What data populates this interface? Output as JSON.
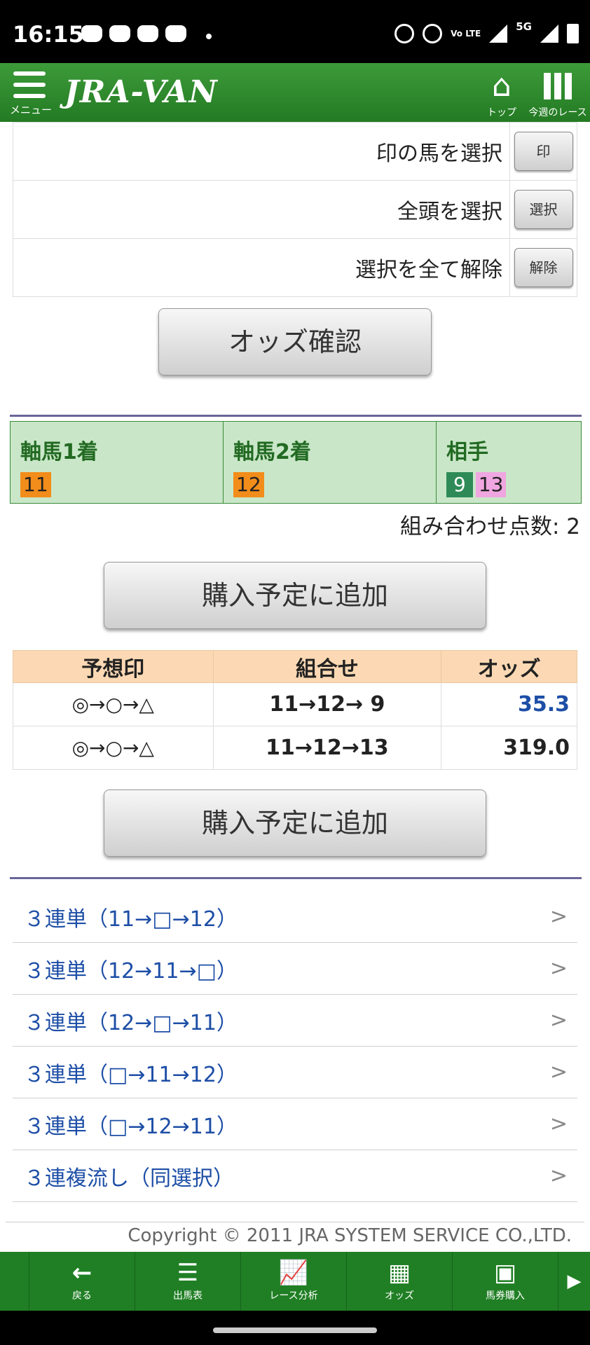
{
  "status_bar": {
    "time": "16:15",
    "network": "5G",
    "volte": "Vo LTE"
  },
  "header": {
    "menu_label": "メニュー",
    "logo": "JRA-VAN",
    "top_label": "トップ",
    "week_label": "今週のレース"
  },
  "selection": [
    {
      "label": "印の馬を選択",
      "button": "印"
    },
    {
      "label": "全頭を選択",
      "button": "選択"
    },
    {
      "label": "選択を全て解除",
      "button": "解除"
    }
  ],
  "odds_check_label": "オッズ確認",
  "axis": {
    "first": {
      "title": "軸馬1着",
      "horses": [
        "11"
      ]
    },
    "second": {
      "title": "軸馬2着",
      "horses": [
        "12"
      ]
    },
    "partner": {
      "title": "相手",
      "horses": [
        "9",
        "13"
      ]
    }
  },
  "combo_count": "組み合わせ点数: 2",
  "add_plan_label": "購入予定に追加",
  "odds_table": {
    "headers": [
      "予想印",
      "組合せ",
      "オッズ"
    ],
    "rows": [
      {
        "mark": "◎→○→△",
        "combo": "11→12→ 9",
        "odds": "35.3"
      },
      {
        "mark": "◎→○→△",
        "combo": "11→12→13",
        "odds": "319.0"
      }
    ]
  },
  "links": [
    "３連単（11→□→12）",
    "３連単（12→11→□）",
    "３連単（12→□→11）",
    "３連単（□→11→12）",
    "３連単（□→12→11）",
    "３連複流し（同選択）"
  ],
  "copyright": "Copyright © 2011 JRA SYSTEM SERVICE CO.,LTD.",
  "bottom_nav": [
    {
      "label": "戻る",
      "icon": "back-arrow-icon"
    },
    {
      "label": "出馬表",
      "icon": "list-icon"
    },
    {
      "label": "レース分析",
      "icon": "chart-icon"
    },
    {
      "label": "オッズ",
      "icon": "grid-icon"
    },
    {
      "label": "馬券購入",
      "icon": "ticket-icon"
    }
  ],
  "colors": {
    "header_green": "#2a8a2a",
    "axis_bg": "#c9e7c8",
    "odds_header": "#fcd9b4",
    "link_blue": "#1d4ea6",
    "chip_orange": "#f28c1a",
    "chip_green": "#2e8b57",
    "chip_pink": "#f0a6e0",
    "odds_highlight": "#1d4ea6"
  }
}
